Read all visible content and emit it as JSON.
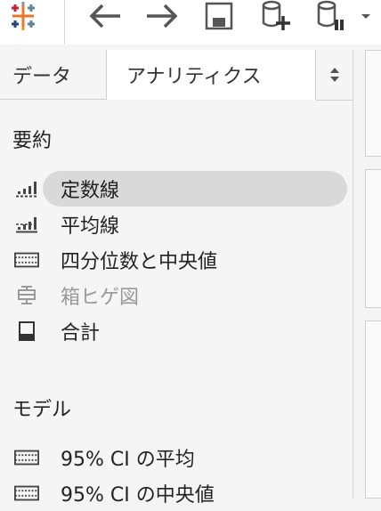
{
  "tabs": {
    "data_label": "データ",
    "analytics_label": "アナリティクス"
  },
  "summary": {
    "title": "要約",
    "items": [
      {
        "label": "定数線",
        "icon": "constant-line-icon"
      },
      {
        "label": "平均線",
        "icon": "average-line-icon"
      },
      {
        "label": "四分位数と中央値",
        "icon": "distribution-band-icon"
      },
      {
        "label": "箱ヒゲ図",
        "icon": "box-plot-icon"
      },
      {
        "label": "合計",
        "icon": "totals-icon"
      }
    ]
  },
  "model": {
    "title": "モデル",
    "items": [
      {
        "label": "95% CI の平均",
        "icon": "distribution-band-icon"
      },
      {
        "label": "95% CI の中央値",
        "icon": "distribution-band-icon"
      }
    ]
  },
  "colors": {
    "selected_bg": "#d9d9d9",
    "disabled_text": "#9a9a9a"
  }
}
